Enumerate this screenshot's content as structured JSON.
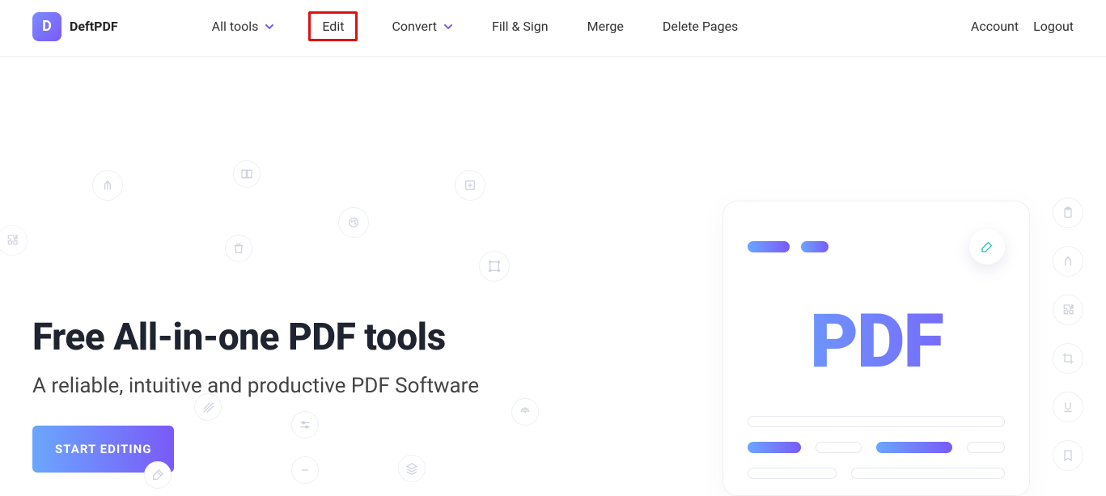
{
  "brand": {
    "logo_letter": "D",
    "name": "DeftPDF"
  },
  "nav": {
    "all_tools": "All tools",
    "edit": "Edit",
    "convert": "Convert",
    "fill_sign": "Fill & Sign",
    "merge": "Merge",
    "delete_pages": "Delete Pages"
  },
  "account_nav": {
    "account": "Account",
    "logout": "Logout"
  },
  "hero": {
    "title": "Free All-in-one PDF tools",
    "subtitle": "A reliable, intuitive and productive PDF Software",
    "cta": "START EDITING"
  },
  "pdf_card": {
    "big_label": "PDF"
  },
  "colors": {
    "gradient_start": "#6aa6ff",
    "gradient_end": "#7a5af8",
    "highlight_box": "#d11"
  }
}
